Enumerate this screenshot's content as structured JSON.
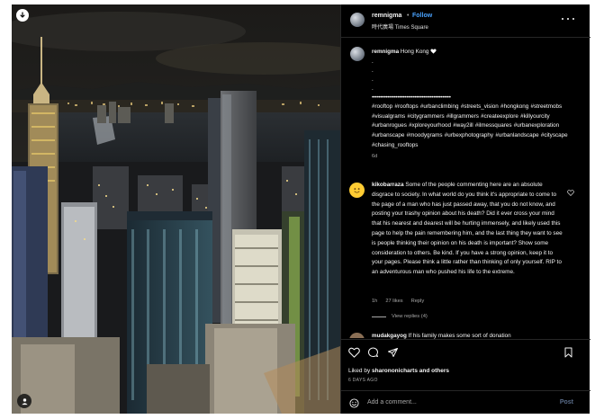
{
  "photo": {
    "alt": "Night view over Hong Kong skyscrapers and Victoria Harbour"
  },
  "header": {
    "username": "remnigma",
    "separator": "•",
    "follow_label": "Follow",
    "location": "時代廣場 Times Square"
  },
  "caption": {
    "username": "remnigma",
    "text": "Hong Kong",
    "dots": [
      ".",
      ".",
      ".",
      "."
    ],
    "divider": "••••••••••••••••••••••••••••••••••••••••••••••",
    "hashtags": "#rooftop #rooftops #urbanclimbing #streets_vision #hongkong #streetmobs #visualgrams #citygrammers #illgrammers #createexplore #killyourcity #urbanrogues #xploreyourhood #way2ill #ilmessquares #urbanexploration #urbanscape #moodygrams #urbexphotography #urbanlandscape #cityscape #chasing_rooftops",
    "age": "6d"
  },
  "comment": {
    "username": "kikobarraza",
    "text": "Some of the people commenting here are an absolute disgrace to society. In what world do you think it's appropriate to come to the page of a man who has just passed away, that you do not know, and posting your trashy opinion about his death? Did it ever cross your mind that his nearest and dearest will be hurting immensely, and likely used this page to help the pain remembering him, and the last thing they want to see is people thinking their opinion on his death is important? Show some consideration to others. Be kind. If you have a strong opinion, keep it to your pages. Please think a little rather than thinking of only yourself. RIP to an adventurous man who pushed his life to the extreme.",
    "age": "1h",
    "likes": "27 likes",
    "reply_label": "Reply",
    "view_replies": "View replies (4)"
  },
  "comment2": {
    "username": "mudakgayog",
    "text": "If his family makes some sort of donation"
  },
  "actions": {
    "liked_by_prefix": "Liked by",
    "liked_by_user": "sharononicharts",
    "liked_by_suffix": "and others",
    "timestamp": "6 DAYS AGO"
  },
  "add_comment": {
    "placeholder": "Add a comment...",
    "post_label": "Post"
  },
  "colors": {
    "background": "#000000",
    "accent": "#4aa3ff",
    "muted": "#a8a8a8",
    "post_disabled": "#5a6d8a"
  },
  "icons": [
    "download-icon",
    "user-tag-icon",
    "more-icon",
    "verified-heart-icon",
    "like-heart-icon",
    "like-icon",
    "comment-icon",
    "share-icon",
    "bookmark-icon",
    "emoji-icon"
  ]
}
